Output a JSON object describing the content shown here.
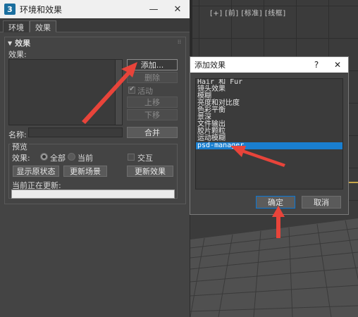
{
  "env_dialog": {
    "title": "环境和效果",
    "app_icon_text": "3",
    "minimize": "—",
    "close": "✕",
    "tabs": [
      "环境",
      "效果"
    ],
    "rollout_title": "效果",
    "effects_label": "效果:",
    "add_button": "添加...",
    "delete_button": "删除",
    "active_label": "活动",
    "move_up_button": "上移",
    "move_down_button": "下移",
    "name_label": "名称:",
    "merge_button": "合并",
    "preview_group": "预览",
    "effects_scope_label": "效果:",
    "radio_all": "全部",
    "radio_current": "当前",
    "interactive_label": "交互",
    "show_original_button": "显示原状态",
    "update_scene_button": "更新场景",
    "update_effect_button": "更新效果",
    "currently_updating_label": "当前正在更新:"
  },
  "viewport": {
    "label": "[+] [前] [标准] [线框]"
  },
  "add_dialog": {
    "title": "添加效果",
    "help": "?",
    "close": "✕",
    "items": [
      "Hair 和 Fur",
      "镜头效果",
      "模糊",
      "亮度和对比度",
      "色彩平衡",
      "景深",
      "文件输出",
      "胶片颗粒",
      "运动模糊",
      "psd-manager"
    ],
    "selected_index": 9,
    "ok_button": "确定",
    "cancel_button": "取消"
  },
  "colors": {
    "annotation_arrow": "#e8443a",
    "selection": "#1a7fd0"
  }
}
